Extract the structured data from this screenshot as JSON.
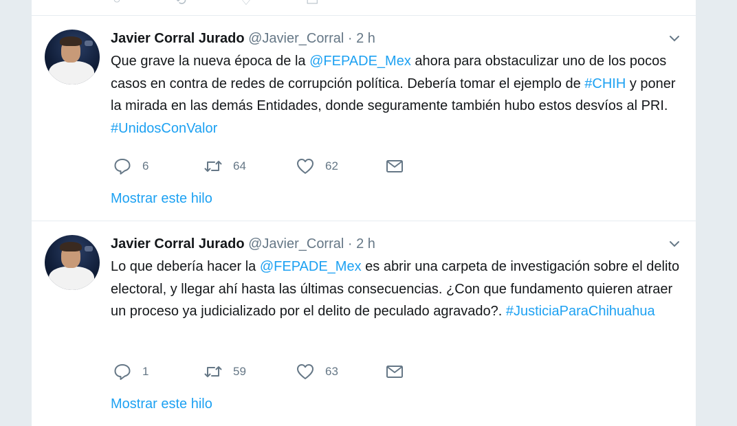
{
  "tweets": [
    {
      "name": "Javier Corral Jurado",
      "handle": "@Javier_Corral",
      "separator": "·",
      "time": "2 h",
      "text": [
        {
          "t": "Que grave la nueva época de la ",
          "link": false
        },
        {
          "t": "@FEPADE_Mex",
          "link": true
        },
        {
          "t": " ahora para obstaculizar uno de los pocos casos en contra de redes de corrupción política. Debería tomar el ejemplo de ",
          "link": false
        },
        {
          "t": "#CHIH",
          "link": true
        },
        {
          "t": " y poner la mirada en las demás Entidades, donde seguramente también hubo estos desvíos al PRI. ",
          "link": false
        },
        {
          "t": "#UnidosConValor",
          "link": true
        }
      ],
      "replies": "6",
      "retweets": "64",
      "likes": "62",
      "show_thread": "Mostrar este hilo"
    },
    {
      "name": "Javier Corral Jurado",
      "handle": "@Javier_Corral",
      "separator": "·",
      "time": "2 h",
      "text": [
        {
          "t": "Lo que debería hacer la ",
          "link": false
        },
        {
          "t": "@FEPADE_Mex",
          "link": true
        },
        {
          "t": " es abrir una carpeta de investigación sobre el delito electoral, y llegar ahí hasta las últimas consecuencias. ¿Con que fundamento quieren atraer un proceso ya judicializado por el delito de peculado agravado?. ",
          "link": false
        },
        {
          "t": "#JusticiaParaChihuahua",
          "link": true
        }
      ],
      "replies": "1",
      "retweets": "59",
      "likes": "63",
      "show_thread": "Mostrar este hilo"
    }
  ],
  "icons": {
    "reply": "reply-icon",
    "retweet": "retweet-icon",
    "like": "heart-icon",
    "message": "envelope-icon",
    "more": "chevron-down-icon"
  },
  "colors": {
    "link": "#1da1f2",
    "text": "#14171a",
    "muted": "#657786",
    "background": "#e6ecf0"
  }
}
